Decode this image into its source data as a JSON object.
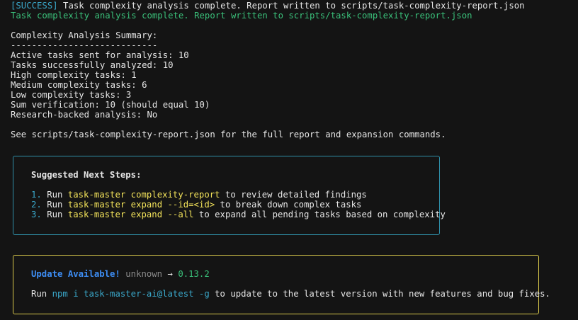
{
  "log": {
    "success_tag": "[SUCCESS]",
    "success_text": " Task complexity analysis complete. Report written to scripts/task-complexity-report.json",
    "complete_line": "Task complexity analysis complete. Report written to scripts/task-complexity-report.json"
  },
  "summary": {
    "title": "Complexity Analysis Summary:",
    "divider": "----------------------------",
    "lines": [
      "Active tasks sent for analysis: 10",
      "Tasks successfully analyzed: 10",
      "High complexity tasks: 1",
      "Medium complexity tasks: 6",
      "Low complexity tasks: 3",
      "Sum verification: 10 (should equal 10)",
      "Research-backed analysis: No"
    ],
    "see_line": "See scripts/task-complexity-report.json for the full report and expansion commands."
  },
  "next_steps": {
    "title": "Suggested Next Steps:",
    "steps": [
      {
        "num": "1.",
        "pre": " Run ",
        "cmd": "task-master complexity-report",
        "post": " to review detailed findings"
      },
      {
        "num": "2.",
        "pre": " Run ",
        "cmd": "task-master expand --id=<id>",
        "post": " to break down complex tasks"
      },
      {
        "num": "3.",
        "pre": " Run ",
        "cmd": "task-master expand --all",
        "post": " to expand all pending tasks based on complexity"
      }
    ]
  },
  "update": {
    "title": "Update Available!",
    "from_version": "unknown",
    "arrow": "→",
    "to_version": "0.13.2",
    "run_pre": "Run ",
    "command": "npm i task-master-ai@latest -g",
    "run_post": " to update to the latest version with new features and bug fixes."
  },
  "colors": {
    "background": "#141414",
    "success": "#3aa7c9",
    "complete": "#3ac07a",
    "command": "#f2e25a",
    "next_border": "#2f8fa8",
    "update_border": "#d8c74a",
    "update_title": "#3d8ef5"
  }
}
